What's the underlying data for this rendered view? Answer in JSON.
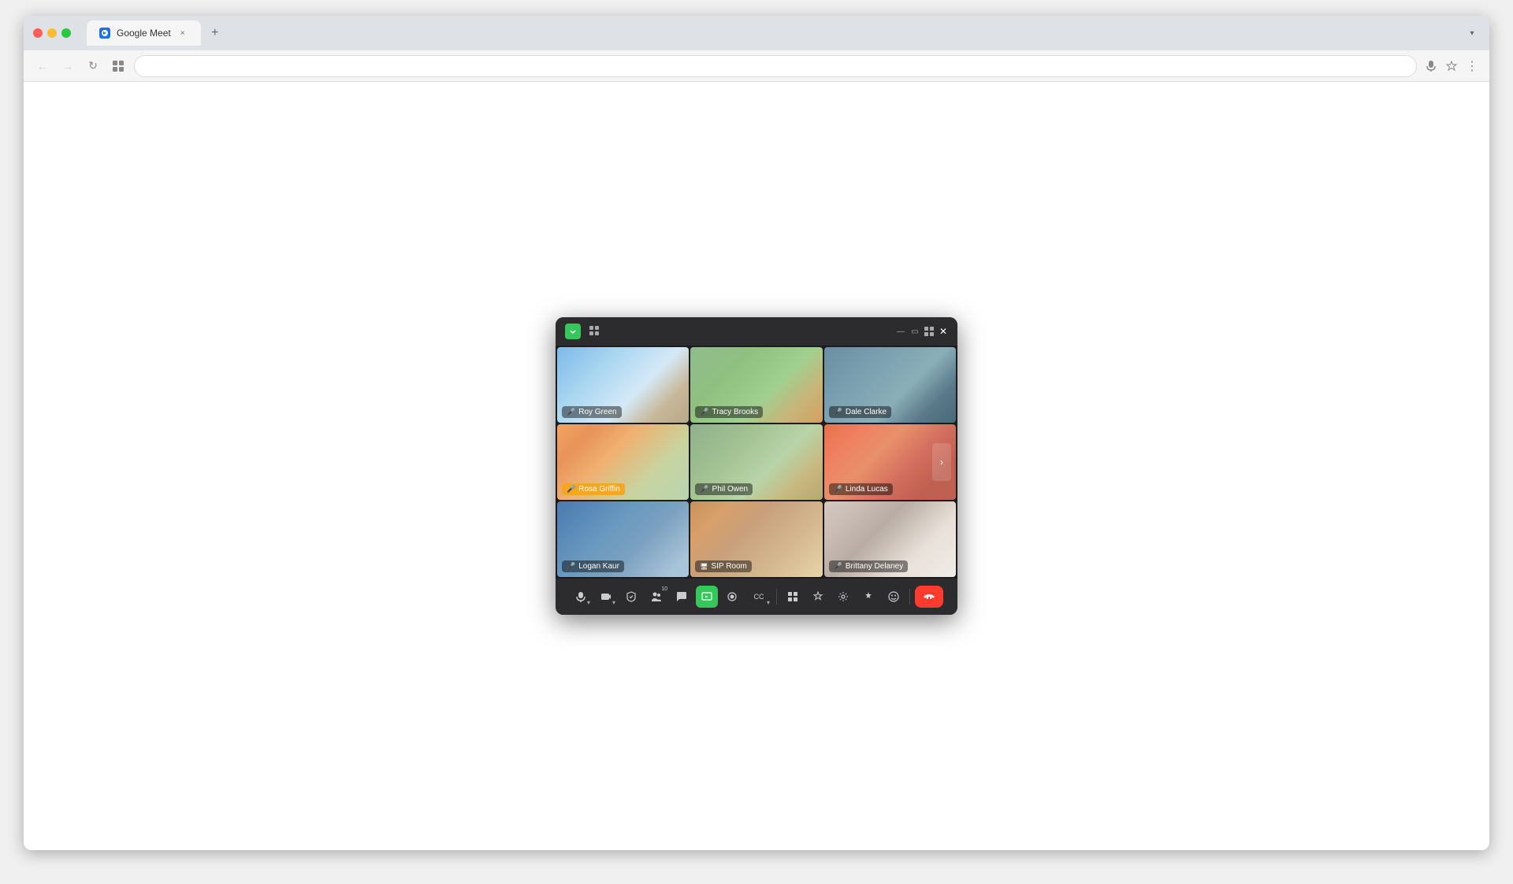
{
  "browser": {
    "tab_label": "Google Meet",
    "tab_close": "×",
    "new_tab": "+",
    "dropdown": "▾",
    "back_disabled": true,
    "forward_disabled": true,
    "refresh_label": "↻",
    "extensions_label": "⊞",
    "mic_label": "🎤",
    "star_label": "☆",
    "menu_label": "⋮"
  },
  "window": {
    "logo_text": "✦",
    "grid_icon": "⊞",
    "controls": [
      "—",
      "▭",
      "⊞",
      "✕"
    ],
    "minimize": "—",
    "restore": "▭",
    "grid_view": "⊞",
    "close": "✕"
  },
  "participants": [
    {
      "name": "Roy Green",
      "style_class": "person-roy",
      "mic_status": "active",
      "mic_icon": "🎤",
      "speaking": false
    },
    {
      "name": "Tracy Brooks",
      "style_class": "person-tracy",
      "mic_status": "active",
      "mic_icon": "🎤",
      "speaking": false
    },
    {
      "name": "Dale Clarke",
      "style_class": "person-dale",
      "mic_status": "muted",
      "mic_icon": "🎤",
      "speaking": false
    },
    {
      "name": "Rosa Griffin",
      "style_class": "person-rosa",
      "mic_status": "muted",
      "mic_icon": "🎤",
      "speaking": true
    },
    {
      "name": "Phil Owen",
      "style_class": "person-phil",
      "mic_status": "muted",
      "mic_icon": "🎤",
      "speaking": false
    },
    {
      "name": "Linda Lucas",
      "style_class": "person-linda",
      "mic_status": "muted",
      "mic_icon": "🎤",
      "speaking": false
    },
    {
      "name": "Logan Kaur",
      "style_class": "person-logan",
      "mic_status": "muted",
      "mic_icon": "🎤",
      "speaking": false
    },
    {
      "name": "SIP Room",
      "style_class": "person-sip",
      "mic_status": "monitor",
      "mic_icon": "🖥",
      "speaking": false
    },
    {
      "name": "Brittany Delaney",
      "style_class": "person-brittany",
      "mic_status": "muted",
      "mic_icon": "🎤",
      "speaking": false
    }
  ],
  "controls": {
    "mic_label": "🎤",
    "camera_label": "📷",
    "shield_label": "🛡",
    "participants_count": "10",
    "chat_label": "💬",
    "share_label": "▶",
    "record_label": "⏺",
    "captions_label": "CC",
    "grid_label": "⊞",
    "reactions_label": "♡",
    "settings_label": "⚙",
    "activities_label": "✦",
    "emoji_label": "☺",
    "end_label": "✕"
  }
}
